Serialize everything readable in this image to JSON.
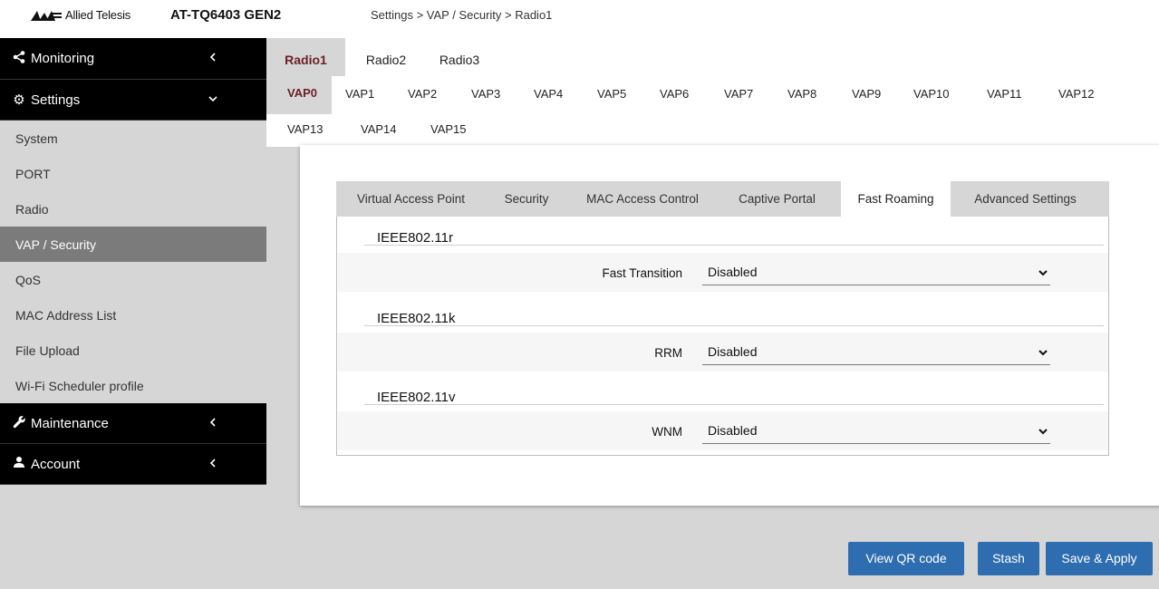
{
  "header": {
    "brand": "Allied Telesis",
    "model": "AT-TQ6403 GEN2",
    "breadcrumb": "Settings > VAP / Security > Radio1"
  },
  "sidebar": {
    "monitoring": "Monitoring",
    "settings": "Settings",
    "items": [
      "System",
      "PORT",
      "Radio",
      "VAP / Security",
      "QoS",
      "MAC Address List",
      "File Upload",
      "Wi-Fi Scheduler profile"
    ],
    "active_item": "VAP / Security",
    "maintenance": "Maintenance",
    "account": "Account"
  },
  "radio_tabs": [
    "Radio1",
    "Radio2",
    "Radio3"
  ],
  "active_radio": "Radio1",
  "vap_tabs": [
    "VAP0",
    "VAP1",
    "VAP2",
    "VAP3",
    "VAP4",
    "VAP5",
    "VAP6",
    "VAP7",
    "VAP8",
    "VAP9",
    "VAP10",
    "VAP11",
    "VAP12",
    "VAP13",
    "VAP14",
    "VAP15"
  ],
  "active_vap": "VAP0",
  "sub_tabs": [
    "Virtual Access Point",
    "Security",
    "MAC Access Control",
    "Captive Portal",
    "Fast Roaming",
    "Advanced Settings"
  ],
  "active_sub_tab": "Fast Roaming",
  "sections": [
    {
      "title": "IEEE802.11r",
      "label": "Fast Transition",
      "value": "Disabled"
    },
    {
      "title": "IEEE802.11k",
      "label": "RRM",
      "value": "Disabled"
    },
    {
      "title": "IEEE802.11v",
      "label": "WNM",
      "value": "Disabled"
    }
  ],
  "buttons": {
    "qr": "View QR code",
    "stash": "Stash",
    "apply": "Save & Apply"
  },
  "colors": {
    "nav_dark": "#000000",
    "sidebar_bg": "#d6d6d6",
    "active_item": "#7b7b7b",
    "button_blue": "#2e6db0",
    "active_tab_text": "#6a1f2a"
  }
}
